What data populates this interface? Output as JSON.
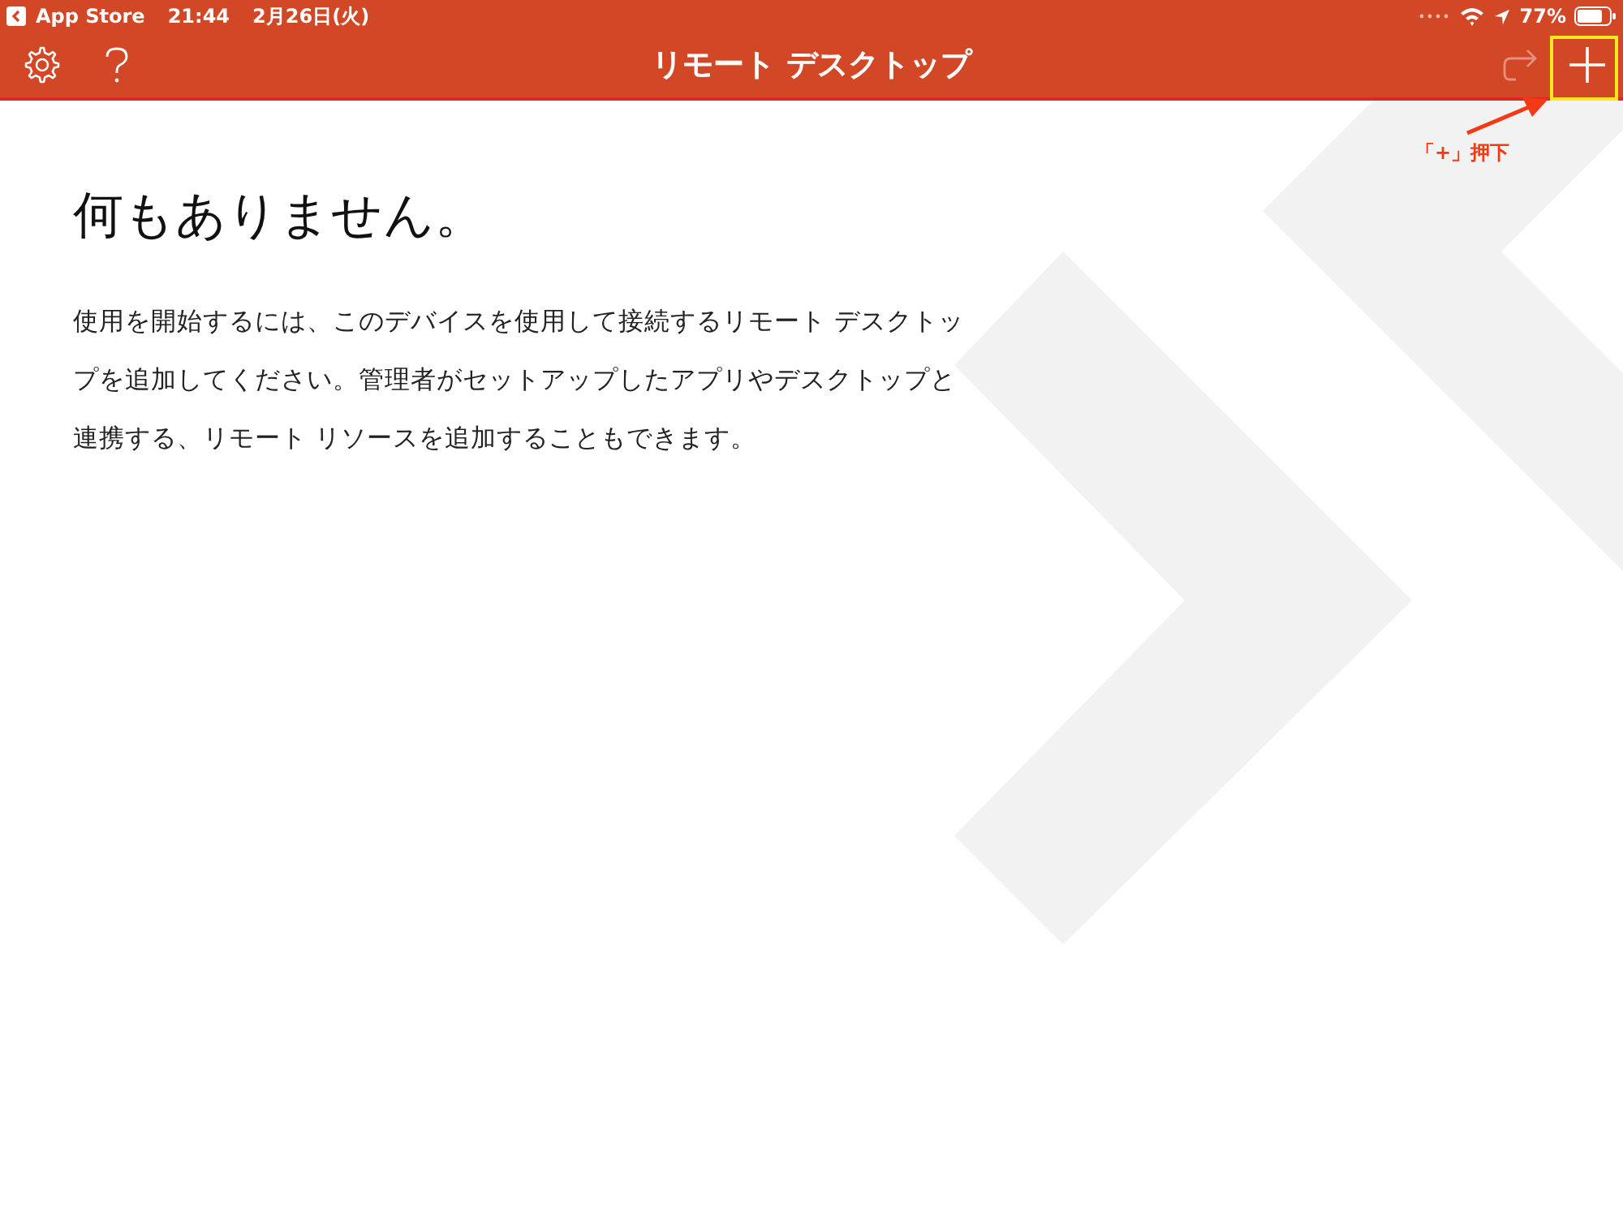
{
  "status_bar": {
    "back_label": "App Store",
    "time": "21:44",
    "date": "2月26日(火)",
    "battery": "77%"
  },
  "nav_bar": {
    "title": "リモート デスクトップ",
    "redo_disabled": true
  },
  "empty_state": {
    "heading": "何もありません。",
    "message": "使用を開始するには、このデバイスを使用して接続するリモート デスクトップを追加してください。管理者がセットアップしたアプリやデスクトップと連携する、リモート リソースを追加することもできます。"
  },
  "annotation": {
    "label": "「+」押下"
  }
}
